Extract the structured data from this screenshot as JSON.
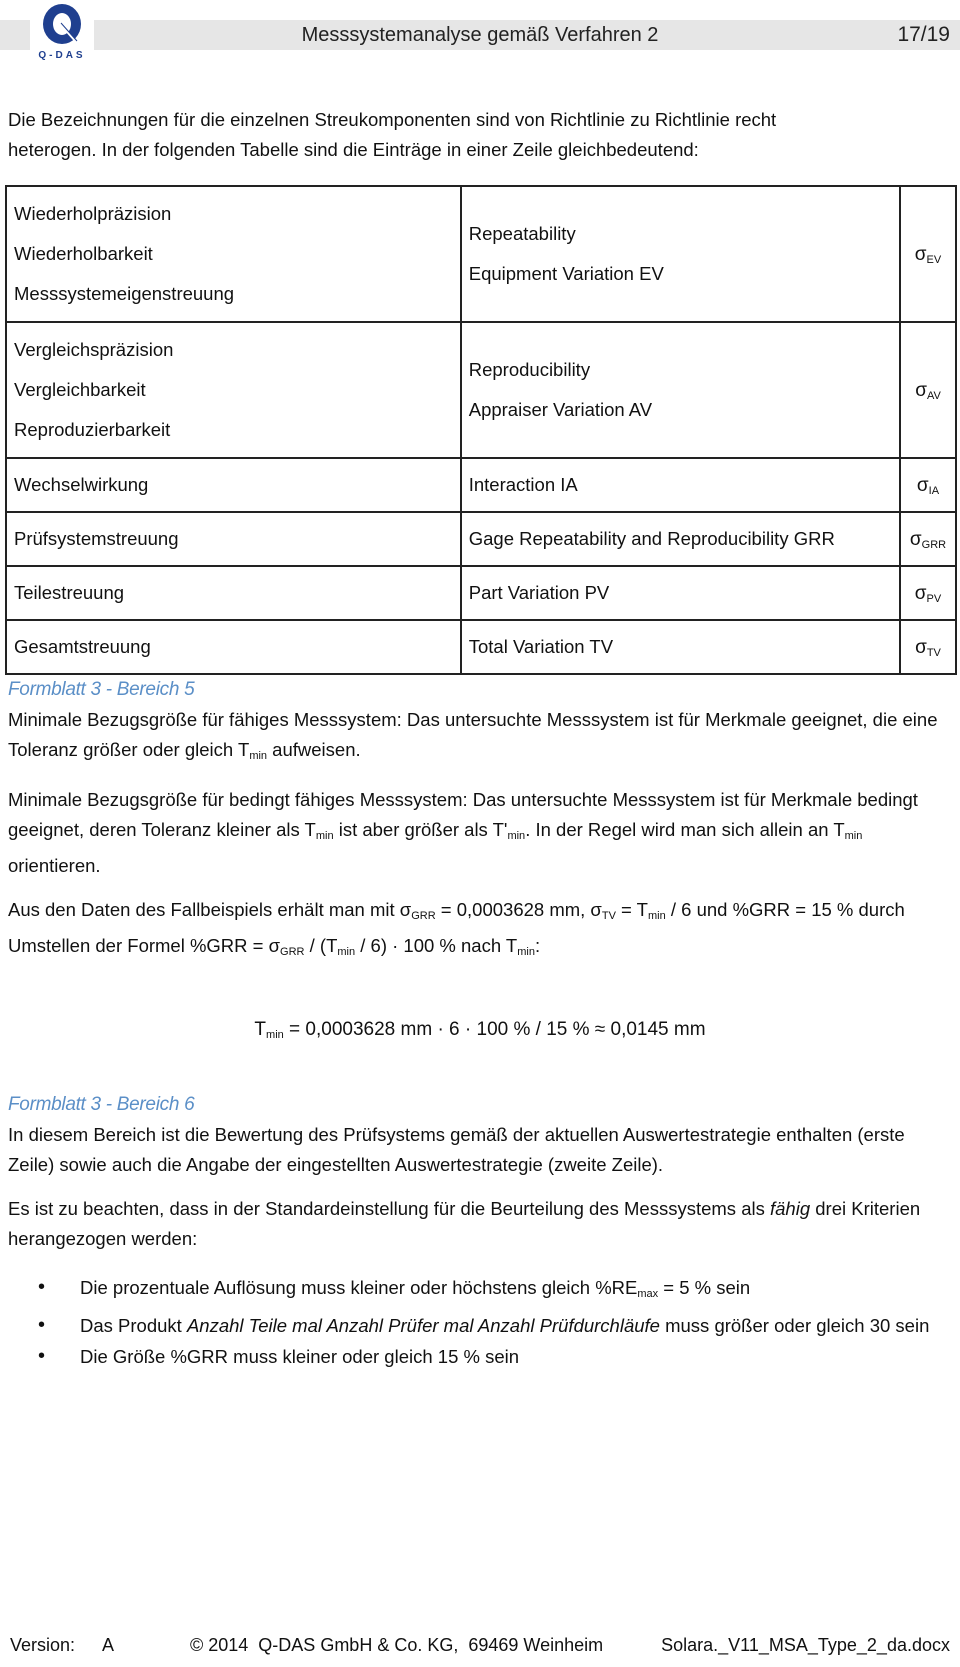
{
  "header": {
    "logo_text": "Q-DAS",
    "title": "Messsystemanalyse gemäß Verfahren 2",
    "page": "17/19"
  },
  "intro": {
    "line1": "Die Bezeichnungen für die einzelnen Streukomponenten sind von Richtlinie zu Richtlinie recht",
    "line2": "heterogen. In der folgenden Tabelle sind die Einträge in einer Zeile gleichbedeutend:"
  },
  "table": {
    "rows": [
      {
        "de": [
          "Wiederholpräzision",
          "Wiederholbarkeit",
          "Messsystemeigenstreuung"
        ],
        "en": [
          "Repeatability",
          "Equipment Variation EV"
        ],
        "symbol": "σ",
        "sub": "EV"
      },
      {
        "de": [
          "Vergleichspräzision",
          "Vergleichbarkeit",
          "Reproduzierbarkeit"
        ],
        "en": [
          "Reproducibility",
          "Appraiser Variation AV"
        ],
        "symbol": "σ",
        "sub": "AV"
      },
      {
        "de": [
          "Wechselwirkung"
        ],
        "en": [
          "Interaction IA"
        ],
        "symbol": "σ",
        "sub": "IA"
      },
      {
        "de": [
          "Prüfsystemstreuung"
        ],
        "en": [
          "Gage Repeatability and Reproducibility GRR"
        ],
        "symbol": "σ",
        "sub": "GRR"
      },
      {
        "de": [
          "Teilestreuung"
        ],
        "en": [
          "Part Variation PV"
        ],
        "symbol": "σ",
        "sub": "PV"
      },
      {
        "de": [
          "Gesamtstreuung"
        ],
        "en": [
          "Total Variation TV"
        ],
        "symbol": "σ",
        "sub": "TV"
      }
    ]
  },
  "section5": {
    "heading": "Formblatt 3 - Bereich 5",
    "p1_a": "Minimale Bezugsgröße für fähiges Messsystem: Das untersuchte Messsystem ist für Merkmale geeignet, die eine Toleranz größer oder gleich T",
    "p1_sub": "min",
    "p1_b": " aufweisen.",
    "p2_a": "Minimale Bezugsgröße für bedingt fähiges Messsystem: Das untersuchte Messsystem ist für Merkmale bedingt geeignet, deren Toleranz kleiner als T",
    "p2_sub1": "min",
    "p2_b": " ist aber größer als T'",
    "p2_sub2": "min",
    "p2_c": ". In der Regel wird man sich allein an T",
    "p2_sub3": "min",
    "p2_d": " orientieren.",
    "p3_a": "Aus den Daten des Fallbeispiels erhält man mit σ",
    "p3_sub1": "GRR",
    "p3_b": " = 0,0003628 mm, σ",
    "p3_sub2": "TV",
    "p3_c": " = T",
    "p3_sub3": "min",
    "p3_d": " / 6 und %GRR = 15 % durch Umstellen der Formel %GRR = σ",
    "p3_sub4": "GRR",
    "p3_e": " / (T",
    "p3_sub5": "min",
    "p3_f": " / 6) · 100 % nach T",
    "p3_sub6": "min",
    "p3_g": ":",
    "formula_a": "T",
    "formula_sub": "min",
    "formula_b": " = 0,0003628 mm · 6 · 100 % / 15 % ≈ 0,0145 mm"
  },
  "section6": {
    "heading": "Formblatt 3 - Bereich 6",
    "p1": "In diesem Bereich ist die Bewertung des Prüfsystems gemäß der aktuellen Auswertestrategie enthalten (erste Zeile) sowie auch die Angabe der eingestellten Auswertestrategie (zweite Zeile).",
    "p2_a": "Es ist zu beachten, dass in der Standardeinstellung für die Beurteilung des Messsystems als ",
    "p2_em": "fähig",
    "p2_b": " drei Kriterien herangezogen werden:",
    "bullets": {
      "b1_a": "Die prozentuale Auflösung muss kleiner oder höchstens gleich %RE",
      "b1_sub": "max",
      "b1_b": " = 5 % sein",
      "b2_a": "Das Produkt ",
      "b2_em": "Anzahl Teile mal Anzahl Prüfer mal Anzahl Prüfdurchläufe",
      "b2_b": " muss größer oder gleich 30 sein",
      "b3": "Die Größe %GRR muss kleiner oder gleich 15 % sein"
    }
  },
  "footer": {
    "version_label": "Version:",
    "version_value": "A",
    "copyright": "© 2014  Q-DAS GmbH & Co. KG,  69469 Weinheim",
    "filename": "Solara._V11_MSA_Type_2_da.docx"
  },
  "colors": {
    "heading": "#5b8fc7",
    "logo_blue": "#1f3f8f",
    "header_band": "#e6e6e6"
  }
}
